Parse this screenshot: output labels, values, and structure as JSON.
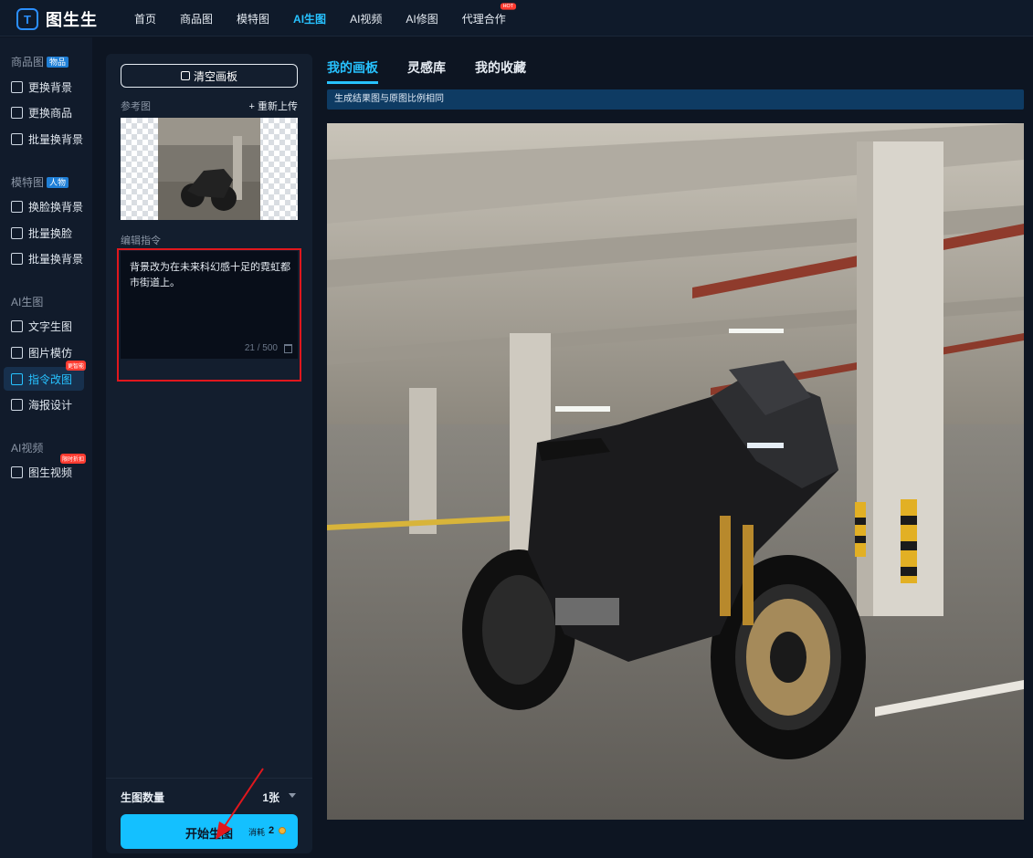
{
  "brand": {
    "name": "图生生"
  },
  "nav": {
    "items": [
      "首页",
      "商品图",
      "模特图",
      "AI生图",
      "AI视频",
      "AI修图",
      "代理合作"
    ],
    "hot_badge": "HOT",
    "active_index": 3
  },
  "sidebar": {
    "sections": [
      {
        "title": "商品图",
        "badge": "物品",
        "items": [
          {
            "label": "更换背景",
            "icon": "image-icon"
          },
          {
            "label": "更换商品",
            "icon": "swap-icon"
          },
          {
            "label": "批量换背景",
            "icon": "images-icon"
          }
        ]
      },
      {
        "title": "模特图",
        "badge": "人物",
        "items": [
          {
            "label": "换脸换背景",
            "icon": "face-swap-icon"
          },
          {
            "label": "批量换脸",
            "icon": "face-scan-icon"
          },
          {
            "label": "批量换背景",
            "icon": "images-icon"
          }
        ]
      },
      {
        "title": "AI生图",
        "badge": "",
        "items": [
          {
            "label": "文字生图",
            "icon": "text-image-icon"
          },
          {
            "label": "图片模仿",
            "icon": "image-copy-icon"
          },
          {
            "label": "指令改图",
            "icon": "edit-icon",
            "tag": "更智能",
            "active": true
          },
          {
            "label": "海报设计",
            "icon": "poster-icon"
          }
        ]
      },
      {
        "title": "AI视频",
        "badge": "",
        "items": [
          {
            "label": "图生视频",
            "icon": "video-icon",
            "tag": "限时折扣"
          }
        ]
      }
    ]
  },
  "panel": {
    "clear_label": "清空画板",
    "ref_label": "参考图",
    "reupload_label": "+ 重新上传",
    "edit_label": "编辑指令",
    "edit_text": "背景改为在未来科幻感十足的霓虹都市街道上。",
    "counter": "21 / 500",
    "count_label": "生图数量",
    "count_value": "1张",
    "start_label": "开始生图",
    "cost_label": "消耗",
    "cost_value": "2"
  },
  "canvas": {
    "tabs": [
      "我的画板",
      "灵感库",
      "我的收藏"
    ],
    "active_tab": 0,
    "notice": "生成结果图与原图比例相同"
  },
  "colors": {
    "accent": "#27c2ff",
    "primary_button": "#14c0ff",
    "highlight_box": "#e0171d",
    "background": "#0d1522"
  }
}
